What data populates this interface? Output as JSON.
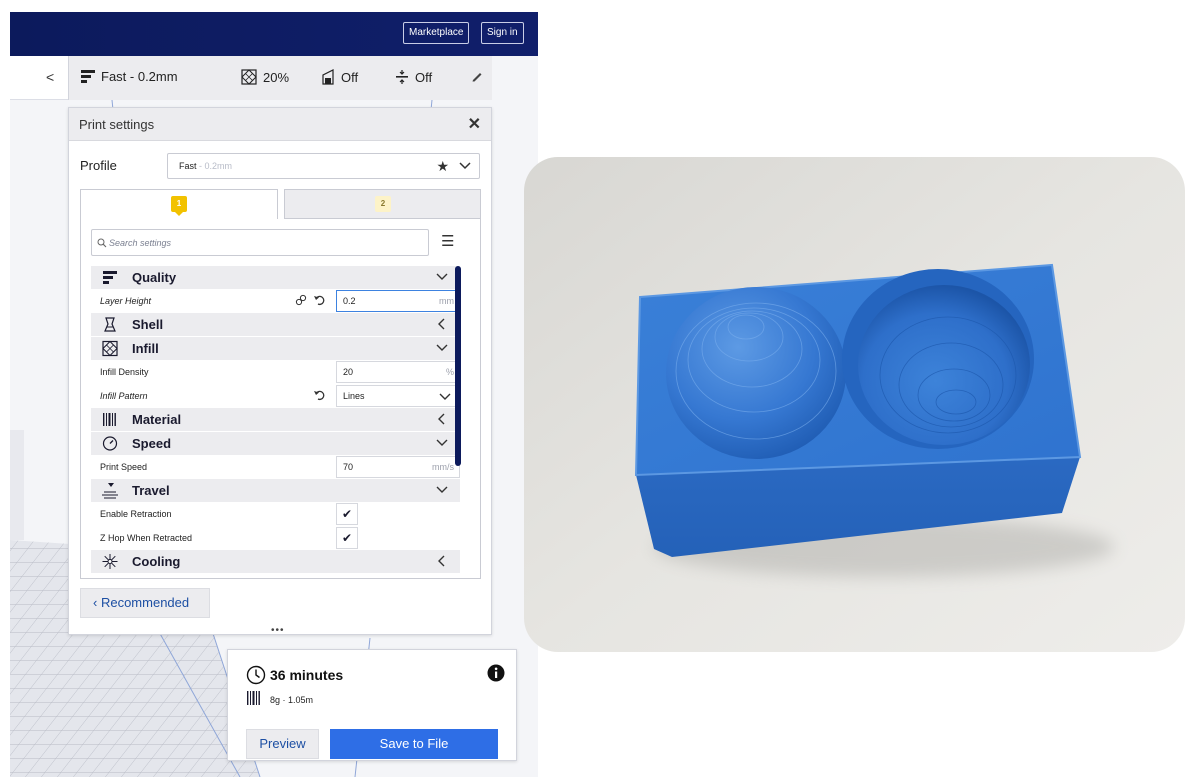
{
  "header": {
    "marketplace_label": "Marketplace",
    "signin_label": "Sign in"
  },
  "job_bar": {
    "collapse_glyph": "<",
    "profile": "Fast - 0.2mm",
    "infill": "20%",
    "support": "Off",
    "adhesion": "Off",
    "edit_icon": "pencil-icon"
  },
  "print_settings": {
    "title": "Print settings",
    "close_glyph": "✕",
    "profile_label": "Profile",
    "profile_value": "Fast",
    "profile_sub": " - 0.2mm",
    "extruder_tabs": [
      {
        "label": "1"
      },
      {
        "label": "2"
      }
    ],
    "search_placeholder": "Search settings",
    "categories": {
      "quality": "Quality",
      "shell": "Shell",
      "infill": "Infill",
      "material": "Material",
      "speed": "Speed",
      "travel": "Travel",
      "cooling": "Cooling"
    },
    "settings": {
      "layer_height": {
        "label": "Layer Height",
        "value": "0.2",
        "unit": "mm"
      },
      "infill_density": {
        "label": "Infill Density",
        "value": "20",
        "unit": "%"
      },
      "infill_pattern": {
        "label": "Infill Pattern",
        "value": "Lines"
      },
      "print_speed": {
        "label": "Print Speed",
        "value": "70",
        "unit": "mm/s"
      },
      "enable_retraction": {
        "label": "Enable Retraction",
        "checked": "✔"
      },
      "z_hop": {
        "label": "Z Hop When Retracted",
        "checked": "✔"
      }
    },
    "recommended_label": "Recommended",
    "grip": "•••"
  },
  "summary": {
    "time": "36 minutes",
    "material": "8g · 1.05m",
    "preview_label": "Preview",
    "save_label": "Save to File"
  },
  "colors": {
    "header_navy": "#0c1a5c",
    "accent_blue": "#2e6ee6",
    "link_blue": "#1d4fa3",
    "badge_yellow": "#f2c200",
    "print_blue": "#2f74cf"
  }
}
